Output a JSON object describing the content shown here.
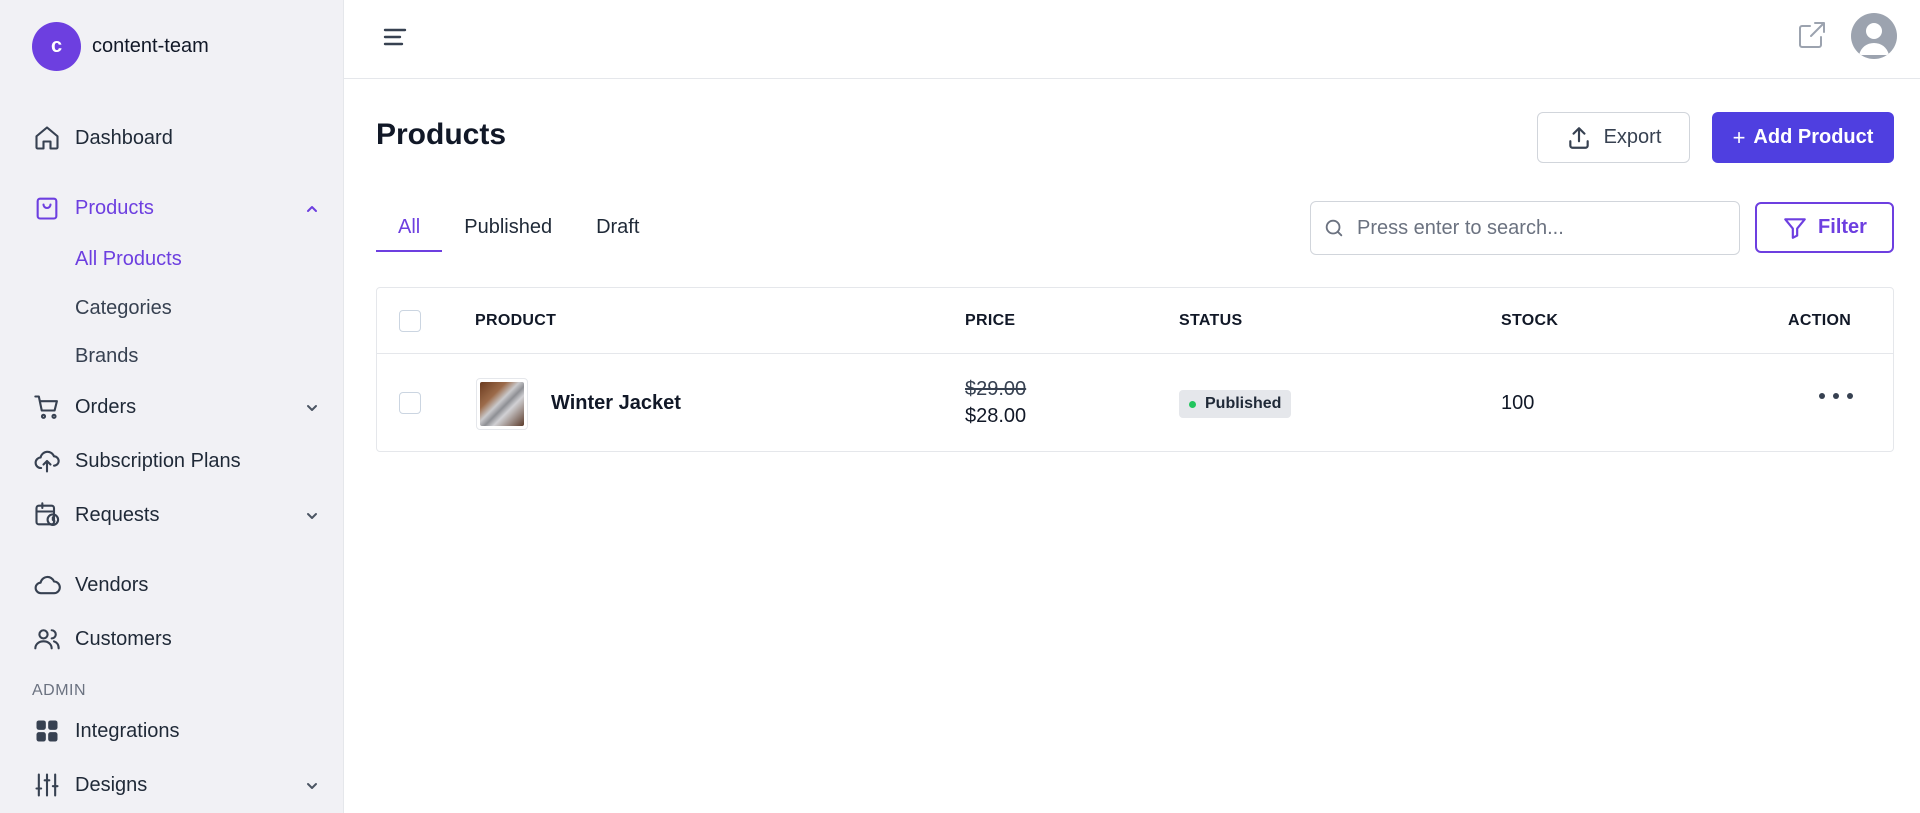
{
  "workspace": {
    "initial": "c",
    "name": "content-team"
  },
  "sidebar": {
    "items": [
      {
        "label": "Dashboard"
      },
      {
        "label": "Products"
      },
      {
        "label": "Orders"
      },
      {
        "label": "Subscription Plans"
      },
      {
        "label": "Requests"
      },
      {
        "label": "Vendors"
      },
      {
        "label": "Customers"
      },
      {
        "label": "Integrations"
      },
      {
        "label": "Designs"
      }
    ],
    "products_sub": [
      "All Products",
      "Categories",
      "Brands"
    ],
    "section_admin": "ADMIN"
  },
  "page": {
    "title": "Products",
    "export_label": "Export",
    "add_label": "Add Product",
    "add_plus": "+",
    "tabs": [
      "All",
      "Published",
      "Draft"
    ],
    "search_placeholder": "Press enter to search...",
    "filter_label": "Filter"
  },
  "table": {
    "headers": [
      "PRODUCT",
      "PRICE",
      "STATUS",
      "STOCK",
      "ACTION"
    ],
    "rows": [
      {
        "name": "Winter Jacket",
        "price_old": "$29.00",
        "price_new": "$28.00",
        "status": "Published",
        "stock": "100"
      }
    ]
  },
  "colors": {
    "accent": "#6d3fe0",
    "primary_button": "#4f3fe0",
    "status_published": "#22c55e"
  },
  "icons": {
    "sidebar": [
      "home-icon",
      "shopping-bag-icon",
      "cart-icon",
      "cloud-upload-icon",
      "calendar-clock-icon",
      "cloud-icon",
      "users-icon",
      "grid-icon",
      "sliders-icon"
    ],
    "topbar": [
      "menu-icon",
      "external-link-icon",
      "user-avatar-icon"
    ],
    "actions": [
      "upload-icon",
      "search-icon",
      "filter-icon",
      "more-horizontal-icon"
    ]
  }
}
